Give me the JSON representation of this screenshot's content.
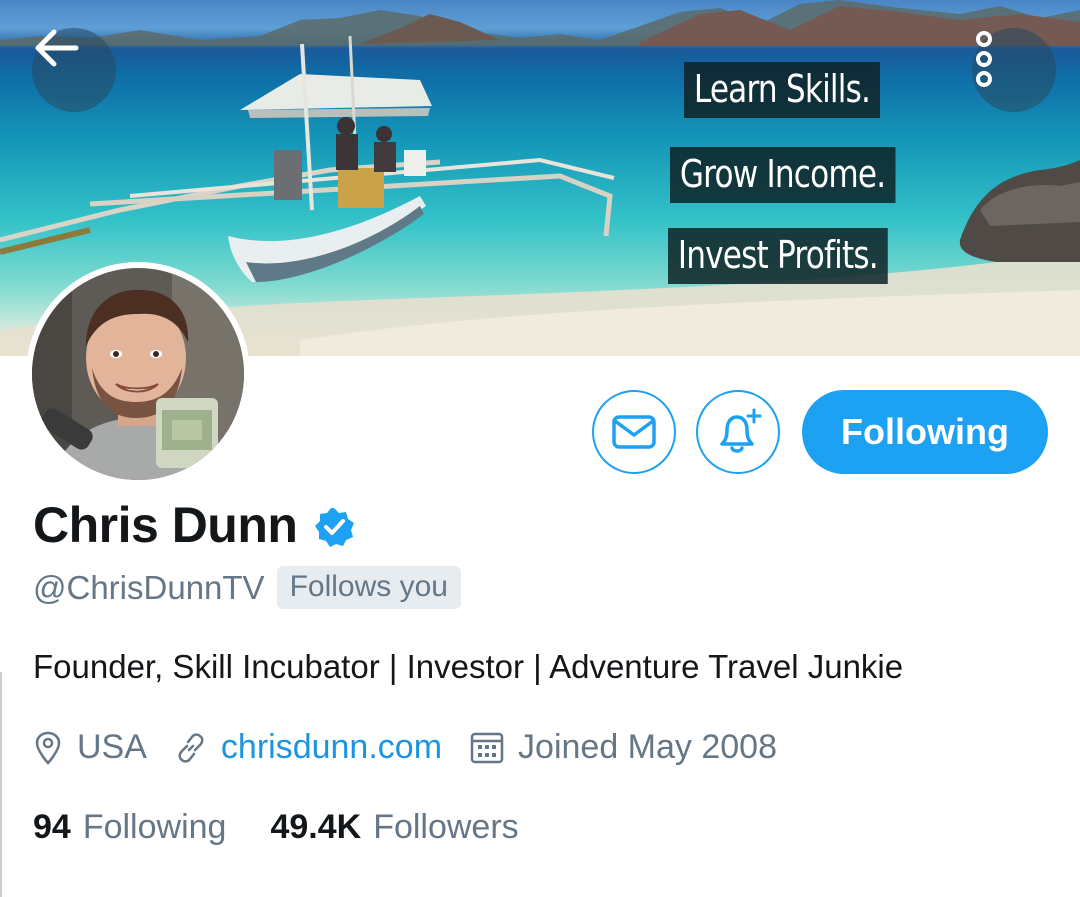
{
  "header": {
    "back_icon": "arrow-left-icon",
    "more_icon": "more-vertical-icon",
    "banner_taglines": [
      "Learn Skills.",
      "Grow Income.",
      "Invest Profits."
    ]
  },
  "actions": {
    "message_icon": "envelope-icon",
    "notifications_icon": "bell-plus-icon",
    "follow_label": "Following"
  },
  "profile": {
    "name": "Chris Dunn",
    "verified": true,
    "handle": "@ChrisDunnTV",
    "follows_you_label": "Follows you",
    "bio": "Founder, Skill Incubator | Investor | Adventure Travel Junkie",
    "location": "USA",
    "website": "chrisdunn.com",
    "joined": "Joined May 2008"
  },
  "stats": {
    "following_count": "94",
    "following_label": "Following",
    "followers_count": "49.4K",
    "followers_label": "Followers"
  },
  "colors": {
    "accent": "#1da1f2",
    "link": "#1b95e0",
    "secondary_text": "#657786",
    "primary_text": "#14171a",
    "badge_bg": "#e6ecf0"
  }
}
